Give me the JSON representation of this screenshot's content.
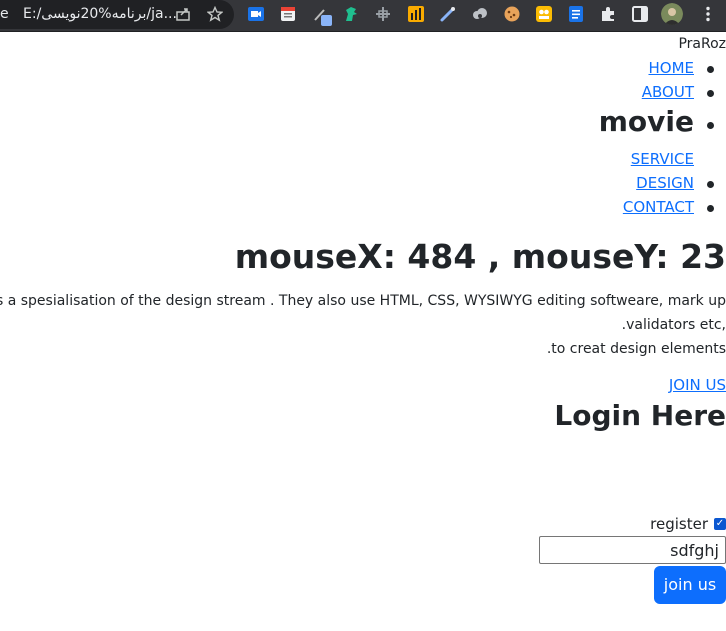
{
  "browser": {
    "edge_text": "e",
    "url": "E:/برنامه%20نویسی/ja...",
    "icons": [
      "share-icon",
      "bookmark-star-icon",
      "meet-ext-icon",
      "calendar-ext-icon",
      "pen-ext-icon",
      "dinosaur-ext-icon",
      "ruler-ext-icon",
      "chart-ext-icon",
      "dropper-ext-icon",
      "cloud-ext-icon",
      "cookie-ext-icon",
      "box-ext-icon",
      "docs-ext-icon",
      "puzzle-icon",
      "sidepanel-icon",
      "avatar",
      "menu-dots-icon"
    ]
  },
  "page": {
    "brand": "PraRoz",
    "nav": {
      "home": "HOME",
      "about": "ABOUT",
      "movie": "movie",
      "service": "SERVICE",
      "design": "DESIGN",
      "contact": "CONTACT"
    },
    "mouse_readout": "mouseX: 484 , mouseY: 23",
    "paragraph": {
      "line1": "s a spesialisation of the design stream . They also use HTML, CSS, WYSIWYG editing softweare, mark up",
      "line2": ".validators etc,",
      "line3": ".to creat design elements"
    },
    "join_link": "JOIN US",
    "login_heading": "Login Here",
    "form": {
      "checkbox_label": "register",
      "checkbox_checked": true,
      "input_value": "sdfghj",
      "submit": "join us"
    }
  },
  "colors": {
    "link": "#0d6efd",
    "button": "#0d6efd",
    "chrome": "#35363a"
  }
}
